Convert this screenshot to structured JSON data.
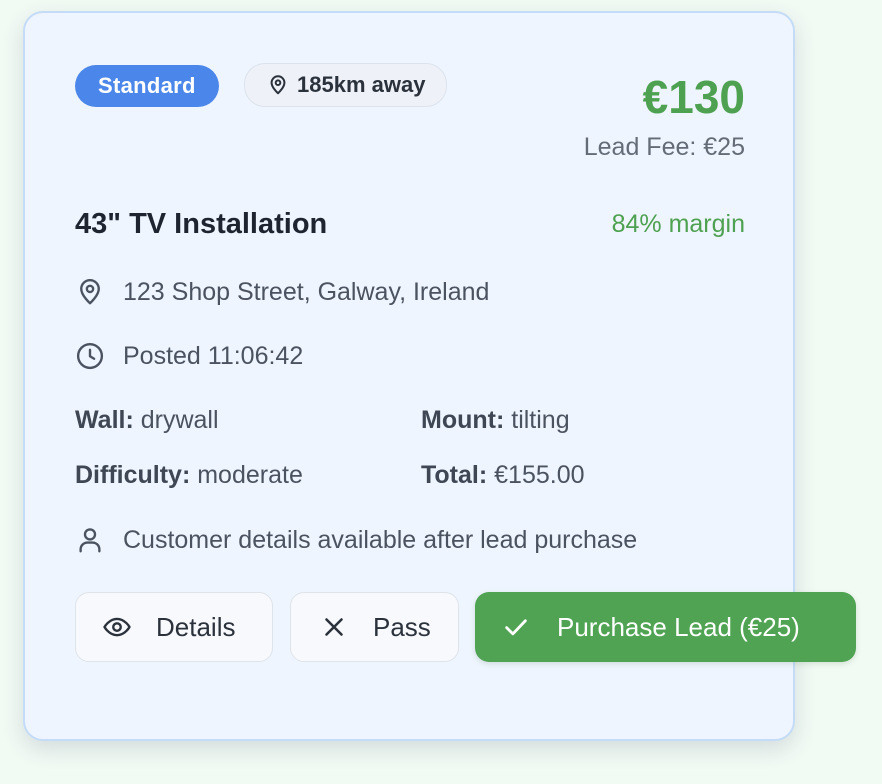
{
  "card": {
    "badge": "Standard",
    "distance": "185km away",
    "price": "€130",
    "lead_fee": "Lead Fee: €25",
    "title": "43\" TV Installation",
    "margin": "84% margin",
    "address": "123 Shop Street, Galway, Ireland",
    "posted": "Posted 11:06:42",
    "specs": {
      "wall_label": "Wall:",
      "wall_value": "drywall",
      "mount_label": "Mount:",
      "mount_value": "tilting",
      "difficulty_label": "Difficulty:",
      "difficulty_value": "moderate",
      "total_label": "Total:",
      "total_value": "€155.00"
    },
    "customer_note": "Customer details available after lead purchase",
    "actions": {
      "details_label": "Details",
      "pass_label": "Pass",
      "purchase_label": "Purchase Lead (€25)"
    }
  },
  "colors": {
    "badge_blue": "#4b87ea",
    "accent_green": "#4ea150",
    "card_background": "#eef5fe",
    "card_border": "#c4dcf7"
  },
  "icons": {
    "distance": "map-pin-icon",
    "address": "map-pin-icon",
    "posted": "clock-icon",
    "customer": "user-icon",
    "details": "eye-icon",
    "pass": "x-icon",
    "purchase": "check-icon"
  }
}
